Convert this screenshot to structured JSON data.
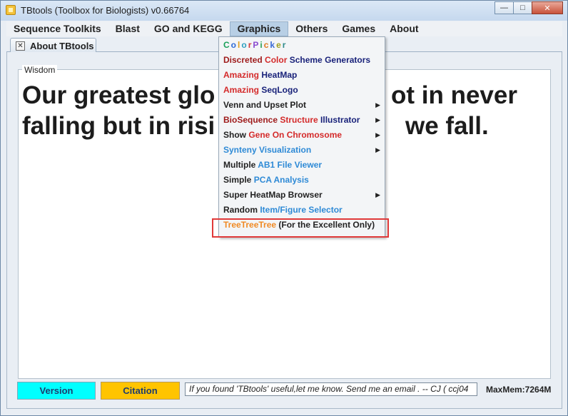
{
  "window": {
    "title": "TBtools (Toolbox for Biologists) v0.66764",
    "controls": {
      "minimize": "—",
      "maximize": "□",
      "close": "✕"
    }
  },
  "menubar": {
    "items": [
      "Sequence Toolkits",
      "Blast",
      "GO and KEGG",
      "Graphics",
      "Others",
      "Games",
      "About"
    ],
    "active": "Graphics"
  },
  "tab": {
    "close_glyph": "✕",
    "label": "About TBtools"
  },
  "wisdom": {
    "legend": "Wisdom",
    "line1_left": "Our greatest glo",
    "line1_right": "ot in never",
    "line2_left": "falling but in risi",
    "line2_right": "we fall."
  },
  "graphics_menu": {
    "colorpicker_letters": [
      "C",
      "o",
      "l",
      "o",
      "r",
      "P",
      "i",
      "c",
      "k",
      "e",
      "r"
    ],
    "colorpicker_colors": [
      "#1aa05a",
      "#2e6ad6",
      "#e0a020",
      "#2ea0c0",
      "#d43a3a",
      "#8a4ad0",
      "#2ea05a",
      "#e07a20",
      "#3a6ad6",
      "#a0a020",
      "#2e8a8a"
    ],
    "items": [
      {
        "parts": [
          [
            "Discreted ",
            "darkred"
          ],
          [
            "Color ",
            "red"
          ],
          [
            "Scheme Generators",
            "navy"
          ]
        ],
        "submenu": false
      },
      {
        "parts": [
          [
            "Amazing ",
            "red"
          ],
          [
            "HeatMap",
            "navy"
          ]
        ],
        "submenu": false
      },
      {
        "parts": [
          [
            "Amazing ",
            "red"
          ],
          [
            "SeqLogo",
            "navy"
          ]
        ],
        "submenu": false
      },
      {
        "parts": [
          [
            "Venn and Upset Plot",
            "dark"
          ]
        ],
        "submenu": true
      },
      {
        "parts": [
          [
            "BioSequence ",
            "darkred"
          ],
          [
            "Structure ",
            "red"
          ],
          [
            "Illustrator",
            "navy"
          ]
        ],
        "submenu": true
      },
      {
        "parts": [
          [
            "Show ",
            "dark"
          ],
          [
            "Gene On Chromosome",
            "red"
          ]
        ],
        "submenu": true
      },
      {
        "parts": [
          [
            "Synteny Visualization",
            "blue"
          ]
        ],
        "submenu": true
      },
      {
        "parts": [
          [
            "Multiple ",
            "dark"
          ],
          [
            "AB1 File Viewer",
            "blue"
          ]
        ],
        "submenu": false
      },
      {
        "parts": [
          [
            "Simple ",
            "dark"
          ],
          [
            "PCA Analysis",
            "blue"
          ]
        ],
        "submenu": false
      },
      {
        "parts": [
          [
            "Super HeatMap Browser",
            "dark"
          ]
        ],
        "submenu": true
      },
      {
        "parts": [
          [
            "Random ",
            "dark"
          ],
          [
            "Item/Figure Selector",
            "blue"
          ]
        ],
        "submenu": false
      },
      {
        "parts": [
          [
            "TreeTreeTree ",
            "orange"
          ],
          [
            "(For the Excellent Only)",
            "dark"
          ]
        ],
        "submenu": false
      }
    ],
    "submenu_arrow": "▶"
  },
  "footer": {
    "version_label": "Version",
    "citation_label": "Citation",
    "message": "If you found 'TBtools' useful,let me know. Send me an email . -- CJ   ( ccj04",
    "maxmem": "MaxMem:7264M"
  },
  "colors": {
    "version_bg": "#00ffff",
    "citation_bg": "#ffc400",
    "highlight": "#e03a3a"
  }
}
